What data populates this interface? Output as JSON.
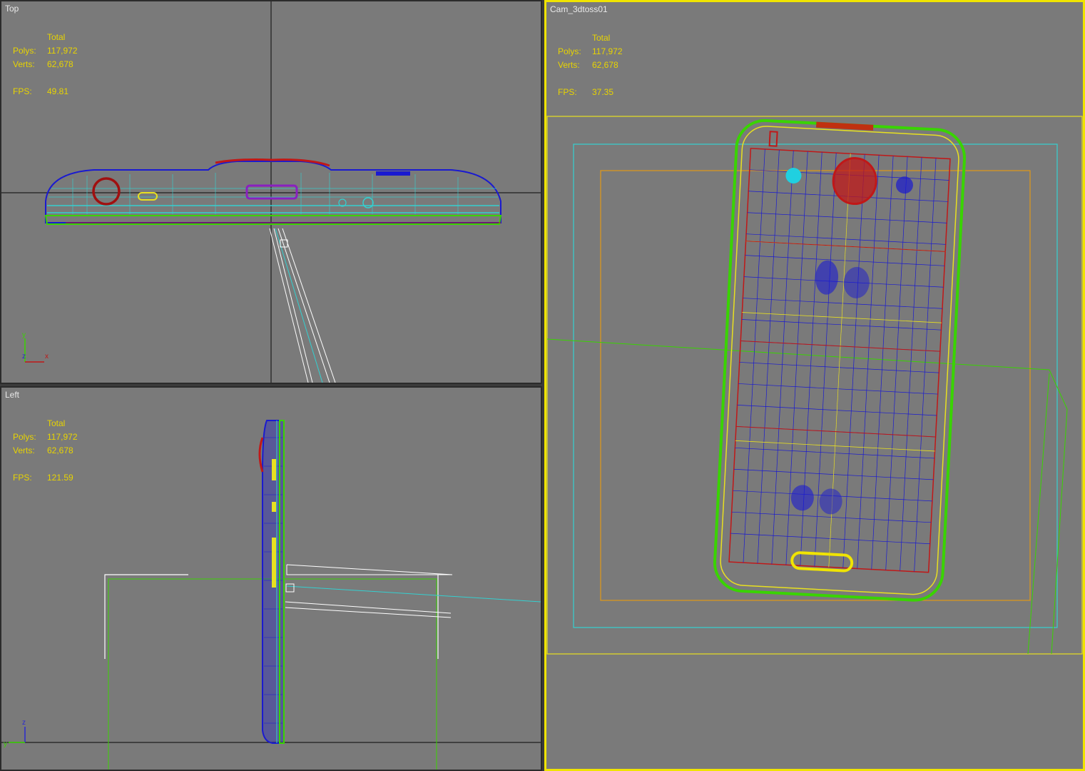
{
  "viewports": {
    "top": {
      "label": "Top",
      "stats": {
        "total_label": "Total",
        "polys_label": "Polys:",
        "polys": "117,972",
        "verts_label": "Verts:",
        "verts": "62,678",
        "fps_label": "FPS:",
        "fps": "49.81"
      },
      "axes": {
        "a": "y",
        "b": "z",
        "c": "x"
      }
    },
    "left": {
      "label": "Left",
      "stats": {
        "total_label": "Total",
        "polys_label": "Polys:",
        "polys": "117,972",
        "verts_label": "Verts:",
        "verts": "62,678",
        "fps_label": "FPS:",
        "fps": "121.59"
      },
      "axes": {
        "a": "z",
        "b": "y"
      }
    },
    "camera": {
      "label": "Cam_3dtoss01",
      "stats": {
        "total_label": "Total",
        "polys_label": "Polys:",
        "polys": "117,972",
        "verts_label": "Verts:",
        "verts": "62,678",
        "fps_label": "FPS:",
        "fps": "37.35"
      }
    }
  },
  "colors": {
    "viewport_bg": "#7a7a7a",
    "active_border": "#f0e400",
    "stats_text": "#e8d400",
    "wire_blue": "#1a1ad0",
    "wire_green": "#39d400",
    "wire_cyan": "#34d0d0",
    "wire_yellow": "#e8e020",
    "wire_red": "#c01818",
    "wire_orange": "#e09818"
  }
}
